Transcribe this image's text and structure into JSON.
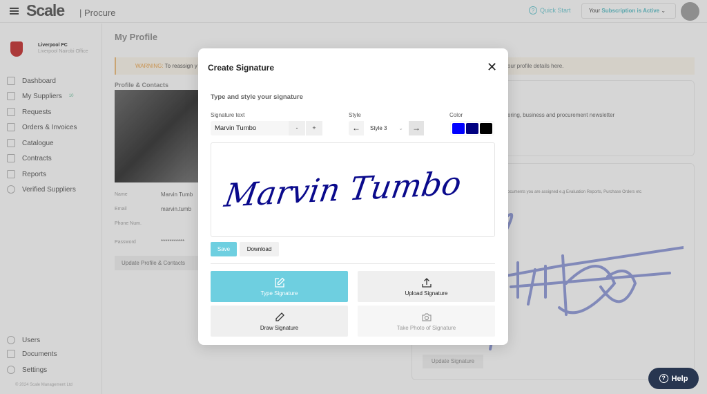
{
  "header": {
    "logo": "Scale",
    "logo_sub": "| Procure",
    "quick_start": "Quick Start",
    "subscription_prefix": "Your",
    "subscription_status": "Subscription is Active"
  },
  "sidebar": {
    "org_name": "Liverpool FC",
    "org_office": "Liverpool Nairobi Office",
    "items": [
      {
        "label": "Dashboard",
        "icon": "dashboard-icon"
      },
      {
        "label": "My Suppliers",
        "icon": "briefcase-icon",
        "badge": "10"
      },
      {
        "label": "Requests",
        "icon": "megaphone-icon"
      },
      {
        "label": "Orders & Invoices",
        "icon": "invoice-icon"
      },
      {
        "label": "Catalogue",
        "icon": "archive-icon"
      },
      {
        "label": "Contracts",
        "icon": "contract-icon"
      },
      {
        "label": "Reports",
        "icon": "reports-icon"
      },
      {
        "label": "Verified Suppliers",
        "icon": "check-circle-icon"
      }
    ],
    "bottom_items": [
      {
        "label": "Users",
        "icon": "user-icon"
      },
      {
        "label": "Documents",
        "icon": "documents-icon"
      },
      {
        "label": "Settings",
        "icon": "gear-icon"
      }
    ],
    "copyright": "© 2024 Scale Management Ltd"
  },
  "main": {
    "title": "My Profile",
    "warning_label": "WARNING:",
    "warning_text": "To reassign y",
    "warning_text_right": "our profile details here.",
    "section": "Profile & Contacts",
    "fields": [
      {
        "label": "Name",
        "value": "Marvin Tumb"
      },
      {
        "label": "Email",
        "value": "marvin.tumb"
      },
      {
        "label": "Phone Num.",
        "value": ""
      },
      {
        "label": "Password",
        "value": "***********"
      }
    ],
    "update_profile": "Update Profile & Contacts",
    "newsletter": "ering, business and procurement newsletter",
    "signature_desc": "ocuments you are assigned e.g Evaluation Reports, Purchase Orders etc",
    "update_signature": "Update Signature",
    "help": "Help"
  },
  "modal": {
    "title": "Create Signature",
    "section": "Type and style your signature",
    "signature_text_label": "Signature text",
    "signature_text": "Marvin Tumbo",
    "minus": "-",
    "plus": "+",
    "style_label": "Style",
    "style_value": "Style 3",
    "color_label": "Color",
    "colors": [
      "#0000ff",
      "#000080",
      "#000000"
    ],
    "save": "Save",
    "download": "Download",
    "options": [
      {
        "label": "Type Signature",
        "icon": "edit-icon",
        "active": true
      },
      {
        "label": "Upload Signature",
        "icon": "upload-icon"
      },
      {
        "label": "Draw Signature",
        "icon": "pencil-icon"
      },
      {
        "label": "Take Photo of Signature",
        "icon": "camera-icon",
        "disabled": true
      }
    ],
    "signature_color": "#0a0a8c"
  }
}
